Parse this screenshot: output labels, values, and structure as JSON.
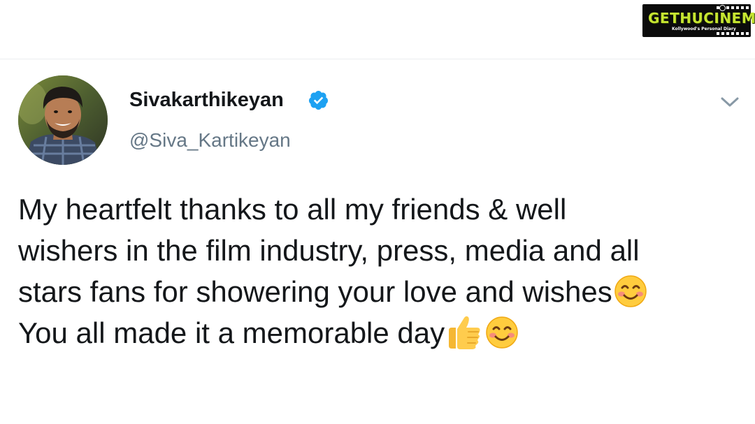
{
  "watermark": {
    "brand": "GETHUCINEMA",
    "tagline": "Kollywood's Personal Diary"
  },
  "tweet": {
    "display_name": "Sivakarthikeyan",
    "handle": "@Siva_Kartikeyan",
    "verified": true,
    "lines": [
      "My heartfelt thanks to all my friends & well",
      "wishers in the film industry, press, media and all",
      "stars fans for showering your love and wishes",
      "You all made it a memorable day"
    ],
    "emojis": [
      "smiling-face-with-smiling-eyes",
      "thumbs-up",
      "smiling-face-with-smiling-eyes"
    ]
  },
  "colors": {
    "text": "#14171a",
    "handle": "#657786",
    "verified_blue": "#1da1f2",
    "logo_green": "#c6e531"
  }
}
